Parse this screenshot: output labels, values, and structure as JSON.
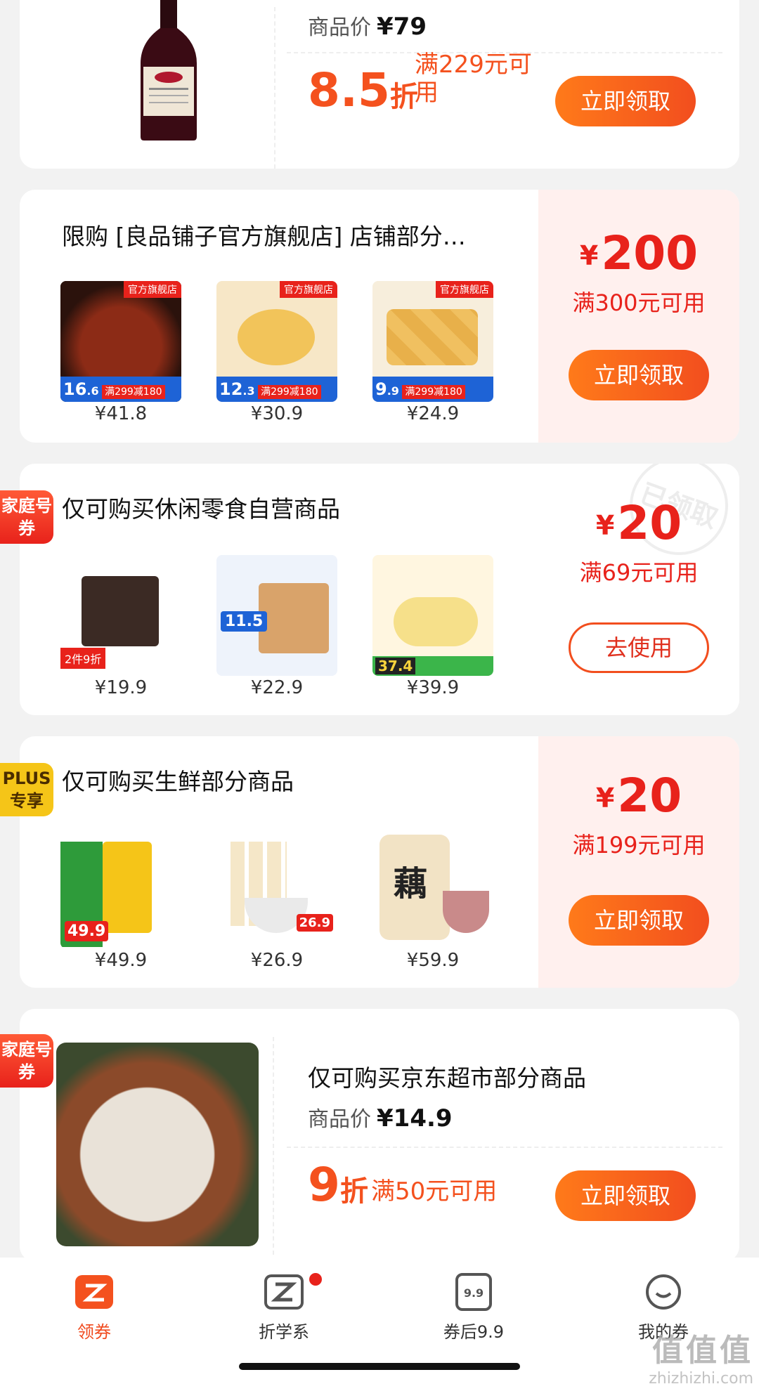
{
  "coupon_top": {
    "price_label": "商品价",
    "price_value": "¥79",
    "discount_value": "8.5",
    "discount_unit": "折",
    "condition": "满229元可用",
    "button": "立即领取"
  },
  "coupons": [
    {
      "title": "限购 [良品铺子官方旗舰店] 店铺部分…",
      "products": [
        {
          "price": "¥41.8",
          "badge_num": "16",
          "badge_dec": ".6",
          "badge_text": "满299减180",
          "store_tag": "官方旗舰店"
        },
        {
          "price": "¥30.9",
          "badge_num": "12",
          "badge_dec": ".3",
          "badge_text": "满299减180",
          "store_tag": "官方旗舰店"
        },
        {
          "price": "¥24.9",
          "badge_num": "9",
          "badge_dec": ".9",
          "badge_text": "满299减180",
          "store_tag": "官方旗舰店"
        }
      ],
      "currency": "¥",
      "amount": "200",
      "condition": "满300元可用",
      "button": "立即领取"
    },
    {
      "tag": "家庭号\n券",
      "title": "仅可购买休闲零食自营商品",
      "products": [
        {
          "price": "¥19.9",
          "promo": "2件9折"
        },
        {
          "price": "¥22.9",
          "promo": "11.5"
        },
        {
          "price": "¥39.9",
          "promo": "37.4"
        }
      ],
      "currency": "¥",
      "amount": "20",
      "condition": "满69元可用",
      "button": "去使用",
      "stamp": "已领取"
    },
    {
      "tag": "PLUS\n专享",
      "title": "仅可购买生鲜部分商品",
      "products": [
        {
          "price": "¥49.9",
          "promo": "49.9"
        },
        {
          "price": "¥26.9",
          "promo": "26.9"
        },
        {
          "price": "¥59.9",
          "promo": "藕"
        }
      ],
      "currency": "¥",
      "amount": "20",
      "condition": "满199元可用",
      "button": "立即领取"
    }
  ],
  "coupon_bottom": {
    "tag": "家庭号\n券",
    "title": "仅可购买京东超市部分商品",
    "price_label": "商品价",
    "price_value": "¥14.9",
    "discount_value": "9",
    "discount_unit": "折",
    "condition": "满50元可用",
    "button": "立即领取"
  },
  "nav": [
    {
      "label": "领券",
      "icon": "coupon-icon",
      "active": true
    },
    {
      "label": "折学系",
      "icon": "z-icon"
    },
    {
      "label": "券后9.9",
      "icon": "ticket-icon",
      "icon_text": "9.9"
    },
    {
      "label": "我的券",
      "icon": "smile-icon"
    }
  ],
  "watermark": {
    "big": "值值值",
    "small": "zhizhizhi.com"
  },
  "colors": {
    "accent": "#f4511e",
    "red": "#e8221b",
    "panel": "#fff0ee"
  }
}
